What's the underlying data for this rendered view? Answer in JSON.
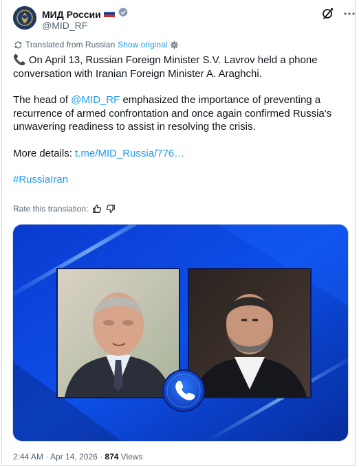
{
  "author": {
    "name": "МИД России",
    "handle": "@MID_RF",
    "verified": true,
    "flag_icon": "russia-flag-icon",
    "badge_icon": "verified-badge-icon"
  },
  "translation": {
    "label": "Translated from Russian",
    "show_original": "Show original",
    "rate_label": "Rate this translation:"
  },
  "tweet": {
    "p1_text": "On April 13, Russian Foreign Minister S.V. Lavrov held a phone conversation with Iranian Foreign Minister A. Araghchi.",
    "p2_before": "The head of ",
    "p2_mention": "@MID_RF",
    "p2_after": " emphasized the importance of preventing a recurrence of armed confrontation and once again confirmed Russia's unwavering readiness to assist in resolving the crisis.",
    "p3_label": "More details: ",
    "p3_link": "t.me/MID_Russia/776…",
    "hashtag": "#RussiaIran"
  },
  "meta": {
    "time": "2:44 AM · Apr 14, 2026 · ",
    "views_count": "874",
    "views_label": " Views"
  },
  "colors": {
    "link": "#1d9bf0",
    "secondary_text": "#536471",
    "media_bg": "#0b3fc4"
  }
}
